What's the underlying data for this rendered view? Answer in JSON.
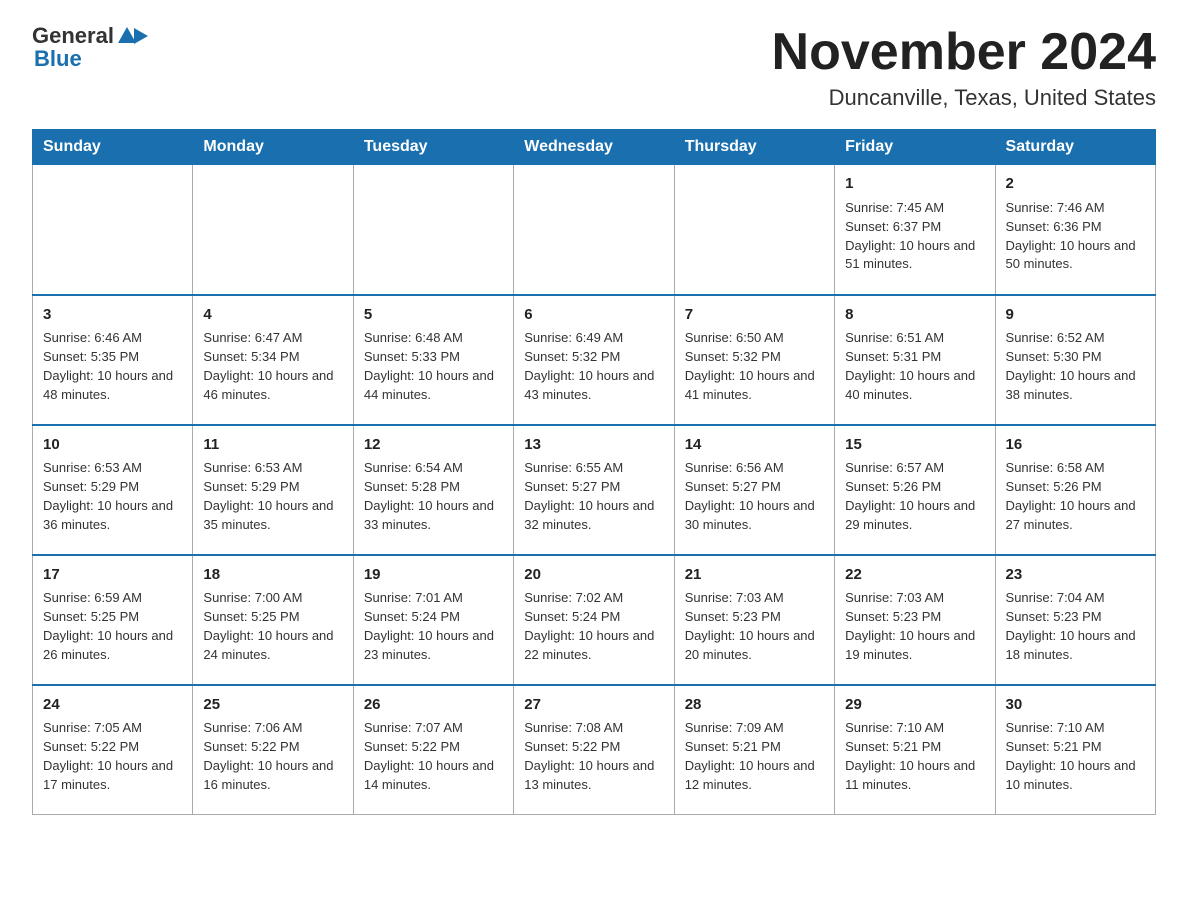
{
  "header": {
    "logo_general": "General",
    "logo_blue": "Blue",
    "title": "November 2024",
    "subtitle": "Duncanville, Texas, United States"
  },
  "days_of_week": [
    "Sunday",
    "Monday",
    "Tuesday",
    "Wednesday",
    "Thursday",
    "Friday",
    "Saturday"
  ],
  "weeks": [
    [
      {
        "day": "",
        "info": ""
      },
      {
        "day": "",
        "info": ""
      },
      {
        "day": "",
        "info": ""
      },
      {
        "day": "",
        "info": ""
      },
      {
        "day": "",
        "info": ""
      },
      {
        "day": "1",
        "info": "Sunrise: 7:45 AM\nSunset: 6:37 PM\nDaylight: 10 hours and 51 minutes."
      },
      {
        "day": "2",
        "info": "Sunrise: 7:46 AM\nSunset: 6:36 PM\nDaylight: 10 hours and 50 minutes."
      }
    ],
    [
      {
        "day": "3",
        "info": "Sunrise: 6:46 AM\nSunset: 5:35 PM\nDaylight: 10 hours and 48 minutes."
      },
      {
        "day": "4",
        "info": "Sunrise: 6:47 AM\nSunset: 5:34 PM\nDaylight: 10 hours and 46 minutes."
      },
      {
        "day": "5",
        "info": "Sunrise: 6:48 AM\nSunset: 5:33 PM\nDaylight: 10 hours and 44 minutes."
      },
      {
        "day": "6",
        "info": "Sunrise: 6:49 AM\nSunset: 5:32 PM\nDaylight: 10 hours and 43 minutes."
      },
      {
        "day": "7",
        "info": "Sunrise: 6:50 AM\nSunset: 5:32 PM\nDaylight: 10 hours and 41 minutes."
      },
      {
        "day": "8",
        "info": "Sunrise: 6:51 AM\nSunset: 5:31 PM\nDaylight: 10 hours and 40 minutes."
      },
      {
        "day": "9",
        "info": "Sunrise: 6:52 AM\nSunset: 5:30 PM\nDaylight: 10 hours and 38 minutes."
      }
    ],
    [
      {
        "day": "10",
        "info": "Sunrise: 6:53 AM\nSunset: 5:29 PM\nDaylight: 10 hours and 36 minutes."
      },
      {
        "day": "11",
        "info": "Sunrise: 6:53 AM\nSunset: 5:29 PM\nDaylight: 10 hours and 35 minutes."
      },
      {
        "day": "12",
        "info": "Sunrise: 6:54 AM\nSunset: 5:28 PM\nDaylight: 10 hours and 33 minutes."
      },
      {
        "day": "13",
        "info": "Sunrise: 6:55 AM\nSunset: 5:27 PM\nDaylight: 10 hours and 32 minutes."
      },
      {
        "day": "14",
        "info": "Sunrise: 6:56 AM\nSunset: 5:27 PM\nDaylight: 10 hours and 30 minutes."
      },
      {
        "day": "15",
        "info": "Sunrise: 6:57 AM\nSunset: 5:26 PM\nDaylight: 10 hours and 29 minutes."
      },
      {
        "day": "16",
        "info": "Sunrise: 6:58 AM\nSunset: 5:26 PM\nDaylight: 10 hours and 27 minutes."
      }
    ],
    [
      {
        "day": "17",
        "info": "Sunrise: 6:59 AM\nSunset: 5:25 PM\nDaylight: 10 hours and 26 minutes."
      },
      {
        "day": "18",
        "info": "Sunrise: 7:00 AM\nSunset: 5:25 PM\nDaylight: 10 hours and 24 minutes."
      },
      {
        "day": "19",
        "info": "Sunrise: 7:01 AM\nSunset: 5:24 PM\nDaylight: 10 hours and 23 minutes."
      },
      {
        "day": "20",
        "info": "Sunrise: 7:02 AM\nSunset: 5:24 PM\nDaylight: 10 hours and 22 minutes."
      },
      {
        "day": "21",
        "info": "Sunrise: 7:03 AM\nSunset: 5:23 PM\nDaylight: 10 hours and 20 minutes."
      },
      {
        "day": "22",
        "info": "Sunrise: 7:03 AM\nSunset: 5:23 PM\nDaylight: 10 hours and 19 minutes."
      },
      {
        "day": "23",
        "info": "Sunrise: 7:04 AM\nSunset: 5:23 PM\nDaylight: 10 hours and 18 minutes."
      }
    ],
    [
      {
        "day": "24",
        "info": "Sunrise: 7:05 AM\nSunset: 5:22 PM\nDaylight: 10 hours and 17 minutes."
      },
      {
        "day": "25",
        "info": "Sunrise: 7:06 AM\nSunset: 5:22 PM\nDaylight: 10 hours and 16 minutes."
      },
      {
        "day": "26",
        "info": "Sunrise: 7:07 AM\nSunset: 5:22 PM\nDaylight: 10 hours and 14 minutes."
      },
      {
        "day": "27",
        "info": "Sunrise: 7:08 AM\nSunset: 5:22 PM\nDaylight: 10 hours and 13 minutes."
      },
      {
        "day": "28",
        "info": "Sunrise: 7:09 AM\nSunset: 5:21 PM\nDaylight: 10 hours and 12 minutes."
      },
      {
        "day": "29",
        "info": "Sunrise: 7:10 AM\nSunset: 5:21 PM\nDaylight: 10 hours and 11 minutes."
      },
      {
        "day": "30",
        "info": "Sunrise: 7:10 AM\nSunset: 5:21 PM\nDaylight: 10 hours and 10 minutes."
      }
    ]
  ]
}
